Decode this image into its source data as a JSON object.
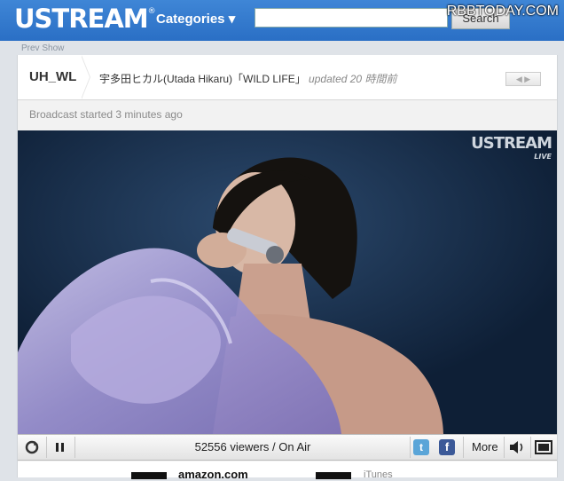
{
  "header": {
    "logo": "USTREAM",
    "logo_mark": "®",
    "categories": "Categories ▾",
    "search_button": "Search",
    "watermark": "RBBTODAY.COM"
  },
  "nav": {
    "prev_show": "Prev Show"
  },
  "channel": {
    "name": "UH_WL",
    "show_title": "宇多田ヒカル(Utada Hikaru)「WILD LIFE」",
    "updated": "updated 20 時間前"
  },
  "status": {
    "broadcast": "Broadcast started 3 minutes ago"
  },
  "video": {
    "logo": "USTREAM",
    "live": "LIVE"
  },
  "player": {
    "viewers": "52556 viewers / On Air",
    "more": "More"
  },
  "ads": {
    "amazon": "amazon.com",
    "itunes": "iTunes"
  },
  "colors": {
    "header": "#3277cd",
    "twitter": "#5aa5d8",
    "facebook": "#3b5998"
  }
}
